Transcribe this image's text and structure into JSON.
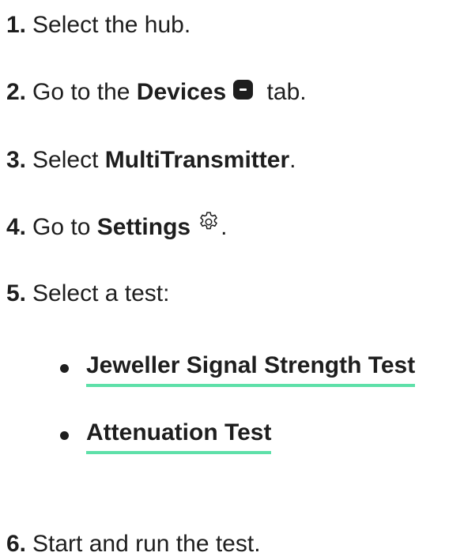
{
  "steps": [
    {
      "num": "1.",
      "text": "Select the hub."
    },
    {
      "num": "2.",
      "pre": "Go to the ",
      "bold": "Devices",
      "post": " tab.",
      "icon": "devices-tab-icon"
    },
    {
      "num": "3.",
      "pre": "Select ",
      "bold": "MultiTransmitter",
      "post": "."
    },
    {
      "num": "4.",
      "pre": "Go to ",
      "bold": "Settings",
      "post": ".",
      "icon": "gear-icon"
    },
    {
      "num": "5.",
      "text": "Select a test:"
    },
    {
      "num": "6.",
      "text": "Start and run the test."
    }
  ],
  "tests": [
    {
      "label": "Jeweller Signal Strength Test"
    },
    {
      "label": "Attenuation Test"
    }
  ],
  "colors": {
    "text": "#1e1e1e",
    "link_underline": "#5ee0a9"
  }
}
